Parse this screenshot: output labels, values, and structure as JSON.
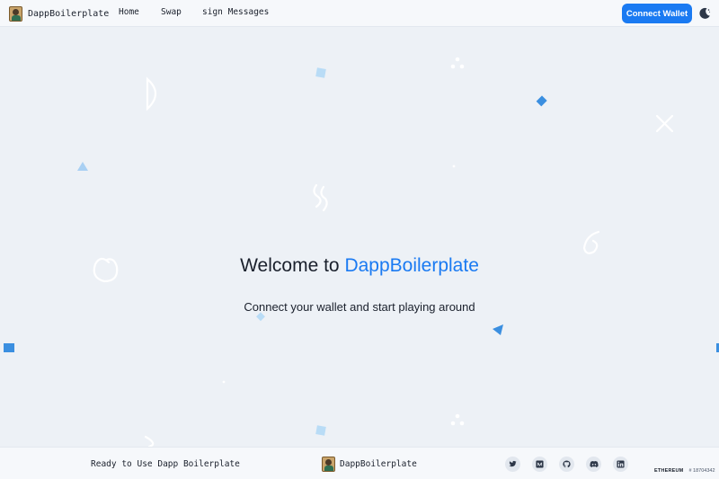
{
  "header": {
    "brand": "DappBoilerplate",
    "nav": [
      {
        "label": "Home"
      },
      {
        "label": "Swap"
      },
      {
        "label": "sign Messages"
      }
    ],
    "connect_label": "Connect Wallet",
    "theme_icon": "moon-icon"
  },
  "hero": {
    "title_prefix": "Welcome to ",
    "title_accent": "DappBoilerplate",
    "subtitle": "Connect your wallet and start playing around"
  },
  "footer": {
    "tagline": "Ready to Use Dapp Boilerplate",
    "brand": "DappBoilerplate",
    "social": [
      {
        "icon": "twitter-icon"
      },
      {
        "icon": "medium-icon"
      },
      {
        "icon": "github-icon"
      },
      {
        "icon": "discord-icon"
      },
      {
        "icon": "linkedin-icon"
      }
    ],
    "network": "ETHEREUM",
    "block": "# 18704342"
  },
  "colors": {
    "accent": "#1a7af2",
    "background": "#edf1f6",
    "shape_blue": "#3b8fe0",
    "shape_light": "#b9dcf6"
  }
}
